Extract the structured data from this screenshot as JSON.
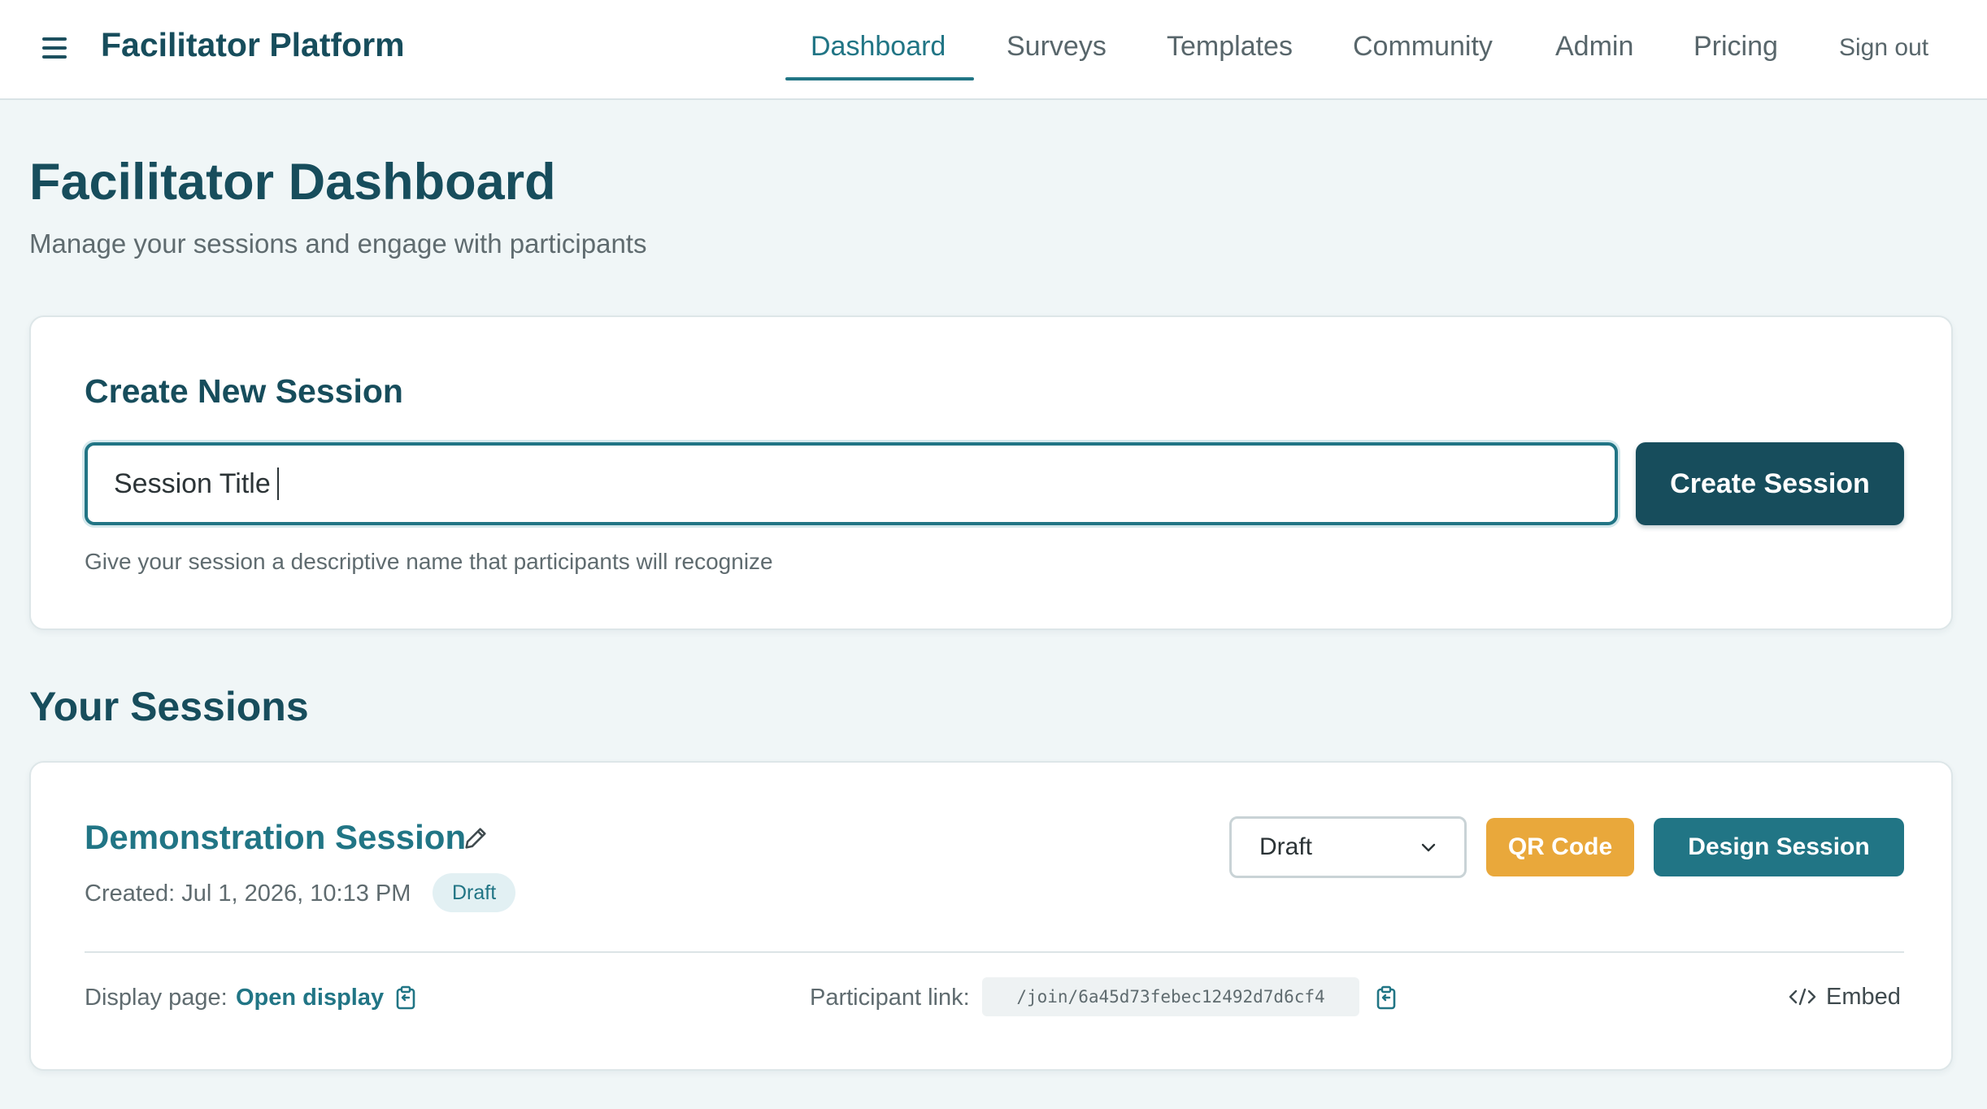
{
  "header": {
    "brand": "Facilitator Platform",
    "nav": [
      {
        "label": "Dashboard",
        "active": true
      },
      {
        "label": "Surveys"
      },
      {
        "label": "Templates"
      },
      {
        "label": "Community"
      },
      {
        "label": "Admin"
      },
      {
        "label": "Pricing"
      }
    ],
    "sign_out": "Sign out"
  },
  "page": {
    "title": "Facilitator Dashboard",
    "subtitle": "Manage your sessions and engage with participants"
  },
  "create_session": {
    "title": "Create New Session",
    "input_value": "Session Title",
    "button_label": "Create Session",
    "helper_text": "Give your session a descriptive name that participants will recognize"
  },
  "sessions": {
    "title": "Your Sessions",
    "items": [
      {
        "name": "Demonstration Session",
        "created": "Created: Jul 1, 2026, 10:13 PM",
        "badge": "Draft",
        "status": "Draft",
        "qr_label": "QR Code",
        "design_label": "Design Session",
        "display_label": "Display page:",
        "display_link": "Open display",
        "participant_label": "Participant link:",
        "participant_link": "/join/6a45d73febec12492d7d6cf4",
        "embed_label": "Embed"
      }
    ]
  },
  "colors": {
    "primary_dark": "#174d5c",
    "accent": "#217585",
    "warning": "#e9a83b",
    "background": "#f0f6f7"
  }
}
